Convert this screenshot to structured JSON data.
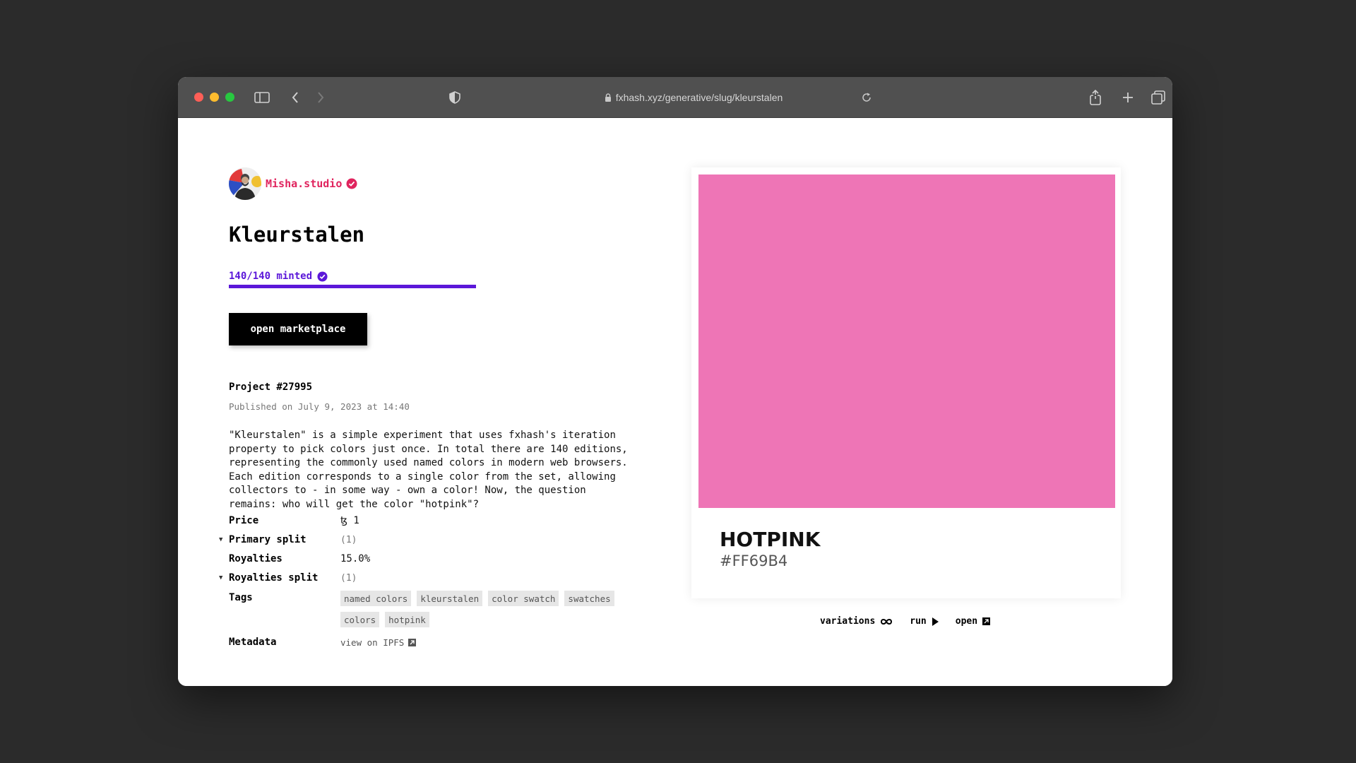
{
  "browser": {
    "url": "fxhash.xyz/generative/slug/kleurstalen"
  },
  "author": {
    "name": "Misha.studio"
  },
  "project": {
    "title": "Kleurstalen",
    "minted": "140/140 minted",
    "minted_fraction": 1.0,
    "marketplace_button": "open marketplace",
    "id_label": "Project #27995",
    "published": "Published on July 9, 2023 at 14:40",
    "description": "\"Kleurstalen\" is a simple experiment that uses fxhash's iteration\nproperty to pick colors just once. In total there are 140 editions,\nrepresenting the commonly used named colors in modern web browsers.\nEach edition corresponds to a single color from the set, allowing\ncollectors to - in some way - own a color! Now, the question\nremains: who will get the color \"hotpink\"?"
  },
  "details": {
    "price_label": "Price",
    "price_value": "ꜩ 1",
    "primary_split_label": "Primary split",
    "primary_split_value": "(1)",
    "royalties_label": "Royalties",
    "royalties_value": "15.0%",
    "royalties_split_label": "Royalties split",
    "royalties_split_value": "(1)",
    "tags_label": "Tags",
    "tags": [
      "named colors",
      "kleurstalen",
      "color swatch",
      "swatches",
      "colors",
      "hotpink"
    ],
    "metadata_label": "Metadata",
    "metadata_link": "view on IPFS"
  },
  "preview": {
    "color_name": "HOTPINK",
    "color_hex": "#FF69B4",
    "swatch_color": "#ee75b6",
    "variations_label": "variations",
    "run_label": "run",
    "open_label": "open"
  },
  "colors": {
    "accent_purple": "#5b17d9",
    "author_pink": "#e0245e"
  }
}
